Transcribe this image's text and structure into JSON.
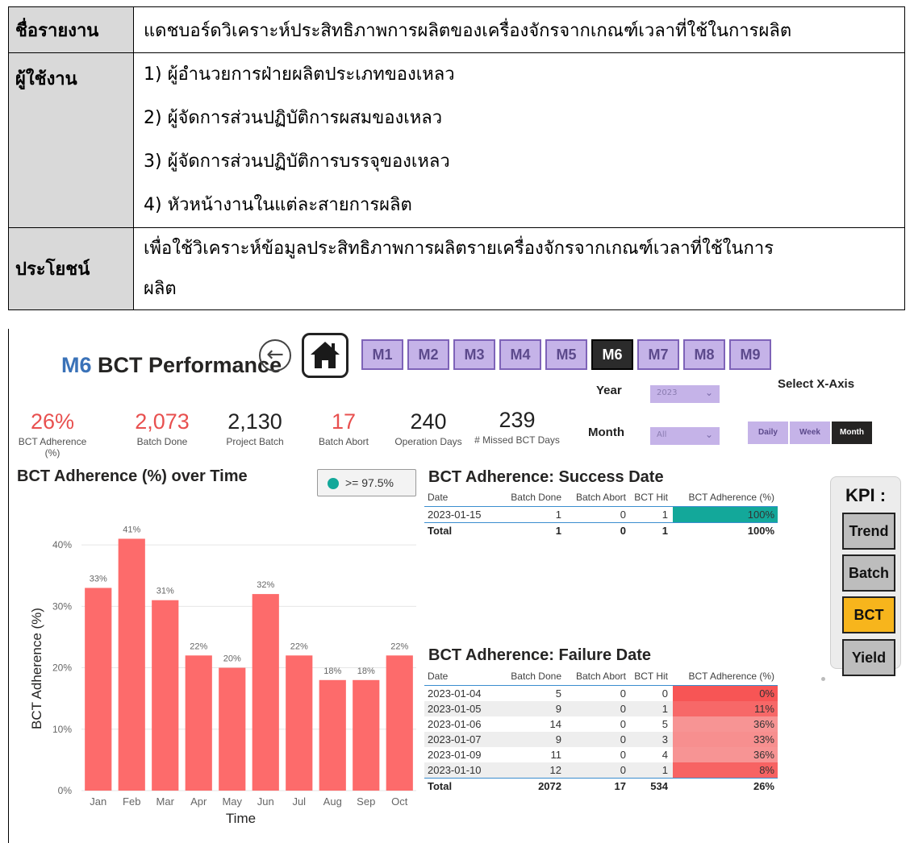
{
  "doc": {
    "report_name_label": "ชื่อรายงาน",
    "report_name_value": "แดชบอร์ดวิเคราะห์ประสิทธิภาพการผลิตของเครื่องจักรจากเกณฑ์เวลาที่ใช้ในการผลิต",
    "users_label": "ผู้ใช้งาน",
    "users": [
      "1) ผู้อำนวยการฝ่ายผลิตประเภทของเหลว",
      "2) ผู้จัดการส่วนปฏิบัติการผสมของเหลว",
      "3) ผู้จัดการส่วนปฏิบัติการบรรจุของเหลว",
      "4) หัวหน้างานในแต่ละสายการผลิต"
    ],
    "benefit_label": "ประโยชน์",
    "benefit_line1": "เพื่อใช้วิเคราะห์ข้อมูลประสิทธิภาพการผลิตรายเครื่องจักรจากเกณฑ์เวลาที่ใช้ในการ",
    "benefit_line2": "ผลิต"
  },
  "dashboard": {
    "title_machine": "M6",
    "title_rest": " BCT Performance",
    "machines": [
      "M1",
      "M2",
      "M3",
      "M4",
      "M5",
      "M6",
      "M7",
      "M8",
      "M9"
    ],
    "active_machine": "M6",
    "kpis": [
      {
        "value": "26%",
        "label": "BCT Adherence (%)",
        "color": "#e8504f"
      },
      {
        "value": "2,073",
        "label": "Batch Done",
        "color": "#e8504f"
      },
      {
        "value": "2,130",
        "label": "Project Batch",
        "color": "#222222"
      },
      {
        "value": "17",
        "label": "Batch Abort",
        "color": "#e8504f"
      },
      {
        "value": "240",
        "label": "Operation Days",
        "color": "#222222"
      },
      {
        "value": "239",
        "label": "# Missed BCT Days",
        "color": "#222222"
      }
    ],
    "filters": {
      "year_label": "Year",
      "year_value": "2023",
      "month_label": "Month",
      "month_value": "All"
    },
    "xaxis": {
      "label": "Select X-Axis",
      "options": [
        "Daily",
        "Week",
        "Month"
      ],
      "selected": "Month"
    },
    "chart_title": "BCT Adherence (%) over Time",
    "legend_text": ">= 97.5%",
    "success_title": "BCT Adherence: Success Date",
    "failure_title": "BCT Adherence: Failure Date",
    "table_headers": [
      "Date",
      "Batch Done",
      "Batch Abort",
      "BCT Hit",
      "BCT Adherence (%)"
    ],
    "success_rows": [
      {
        "date": "2023-01-15",
        "done": "1",
        "abort": "0",
        "hit": "1",
        "pct": "100%",
        "pct_num": 100
      }
    ],
    "success_total": {
      "label": "Total",
      "done": "1",
      "abort": "0",
      "hit": "1",
      "pct": "100%"
    },
    "failure_rows": [
      {
        "date": "2023-01-04",
        "done": "5",
        "abort": "0",
        "hit": "0",
        "pct": "0%",
        "pct_num": 0
      },
      {
        "date": "2023-01-05",
        "done": "9",
        "abort": "0",
        "hit": "1",
        "pct": "11%",
        "pct_num": 11
      },
      {
        "date": "2023-01-06",
        "done": "14",
        "abort": "0",
        "hit": "5",
        "pct": "36%",
        "pct_num": 36
      },
      {
        "date": "2023-01-07",
        "done": "9",
        "abort": "0",
        "hit": "3",
        "pct": "33%",
        "pct_num": 33
      },
      {
        "date": "2023-01-09",
        "done": "11",
        "abort": "0",
        "hit": "4",
        "pct": "36%",
        "pct_num": 36
      },
      {
        "date": "2023-01-10",
        "done": "12",
        "abort": "0",
        "hit": "1",
        "pct": "8%",
        "pct_num": 8
      }
    ],
    "failure_total": {
      "label": "Total",
      "done": "2072",
      "abort": "17",
      "hit": "534",
      "pct": "26%"
    },
    "kpi_panel": {
      "title": "KPI :",
      "buttons": [
        "Trend",
        "Batch",
        "BCT",
        "Yield"
      ],
      "active": "BCT"
    },
    "colors": {
      "bar": "#fd6b6b",
      "success": "#13a89a",
      "accent_purple": "#c5b3e8",
      "kpi_active": "#f7b51c"
    }
  },
  "chart_data": {
    "type": "bar",
    "title": "BCT Adherence (%) over Time",
    "xlabel": "Time",
    "ylabel": "BCT Adherence (%)",
    "categories": [
      "Jan",
      "Feb",
      "Mar",
      "Apr",
      "May",
      "Jun",
      "Jul",
      "Aug",
      "Sep",
      "Oct"
    ],
    "values": [
      33,
      41,
      31,
      22,
      20,
      32,
      22,
      18,
      18,
      22
    ],
    "value_labels": [
      "33%",
      "41%",
      "31%",
      "22%",
      "20%",
      "32%",
      "22%",
      "18%",
      "18%",
      "22%"
    ],
    "yticks": [
      "0%",
      "10%",
      "20%",
      "30%",
      "40%"
    ],
    "ylim": [
      0,
      45
    ],
    "grid": true
  }
}
